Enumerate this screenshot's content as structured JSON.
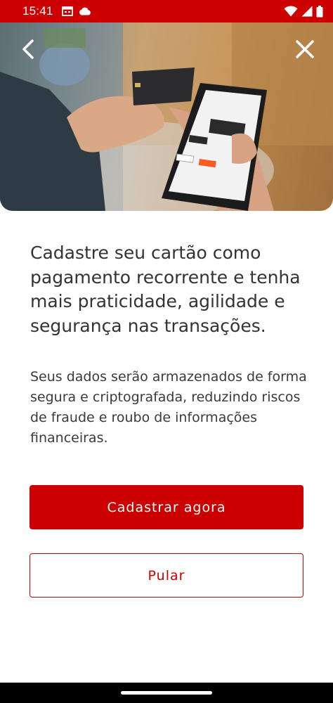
{
  "status_bar": {
    "time": "15:41",
    "background": "#cc0000",
    "icons_left": [
      "calendar-icon",
      "cloud-icon"
    ],
    "icons_right": [
      "wifi-icon",
      "signal-icon",
      "battery-icon"
    ]
  },
  "hero": {
    "back_icon": "chevron-left-icon",
    "close_icon": "close-icon",
    "image": "hand-holding-card-and-phone-photo"
  },
  "content": {
    "headline": "Cadastre seu cartão como pagamento recorrente e tenha mais praticidade, agilidade e segurança nas transações.",
    "description": "Seus dados serão armazenados de forma segura e criptografada, reduzindo riscos de fraude e roubo de informações financeiras."
  },
  "actions": {
    "primary_label": "Cadastrar agora",
    "secondary_label": "Pular"
  },
  "colors": {
    "brand": "#cc0000",
    "text": "#333333",
    "background": "#ffffff"
  }
}
